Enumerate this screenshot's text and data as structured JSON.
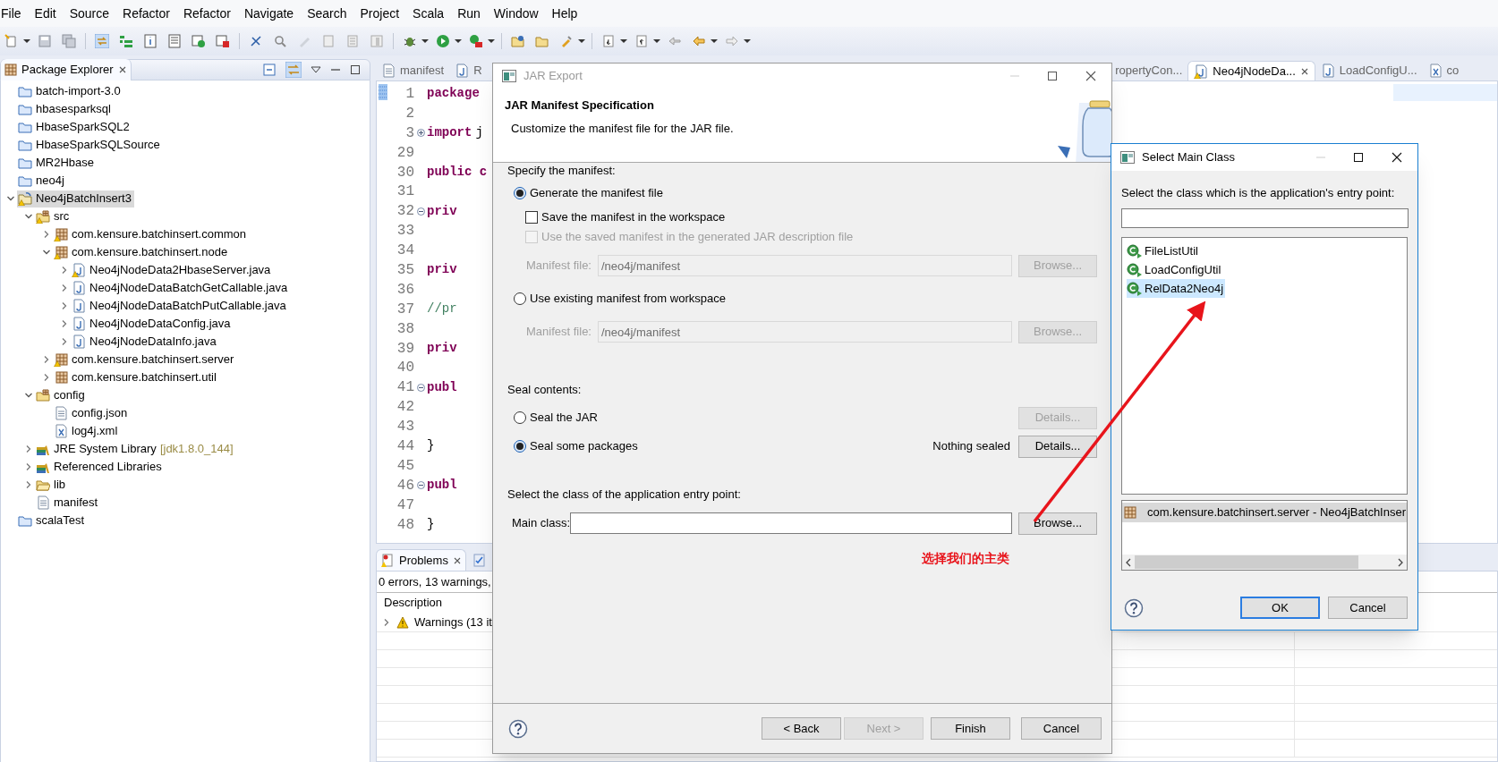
{
  "menu_bar": [
    "File",
    "Edit",
    "Source",
    "Refactor",
    "Refactor",
    "Navigate",
    "Search",
    "Project",
    "Scala",
    "Run",
    "Window",
    "Help"
  ],
  "package_explorer": {
    "title": "Package Explorer",
    "tree": [
      {
        "label": "batch-import-3.0",
        "kind": "project",
        "selected": false,
        "warning": false
      },
      {
        "label": "hbasesparksql",
        "kind": "project",
        "selected": false,
        "warning": false
      },
      {
        "label": "HbaseSparkSQL2",
        "kind": "project",
        "selected": false,
        "warning": false
      },
      {
        "label": "HbaseSparkSQLSource",
        "kind": "project",
        "selected": false,
        "warning": false
      },
      {
        "label": "MR2Hbase",
        "kind": "project",
        "selected": false,
        "warning": false
      },
      {
        "label": "neo4j",
        "kind": "project",
        "selected": false,
        "warning": false
      },
      {
        "label": "Neo4jBatchInsert3",
        "kind": "project_open",
        "selected": true,
        "warning": true,
        "expanded": true,
        "children": [
          {
            "label": "src",
            "kind": "source_folder",
            "selected": false,
            "warning": true,
            "expanded": true,
            "children": [
              {
                "label": "com.kensure.batchinsert.common",
                "kind": "package",
                "selected": false,
                "warning": true,
                "expanded": false
              },
              {
                "label": "com.kensure.batchinsert.node",
                "kind": "package",
                "selected": false,
                "warning": true,
                "expanded": true,
                "children": [
                  {
                    "label": "Neo4jNodeData2HbaseServer.java",
                    "kind": "java",
                    "selected": false,
                    "warning": true,
                    "expanded": false
                  },
                  {
                    "label": "Neo4jNodeDataBatchGetCallable.java",
                    "kind": "java",
                    "selected": false,
                    "warning": false,
                    "expanded": false
                  },
                  {
                    "label": "Neo4jNodeDataBatchPutCallable.java",
                    "kind": "java",
                    "selected": false,
                    "warning": false,
                    "expanded": false
                  },
                  {
                    "label": "Neo4jNodeDataConfig.java",
                    "kind": "java",
                    "selected": false,
                    "warning": false,
                    "expanded": false
                  },
                  {
                    "label": "Neo4jNodeDataInfo.java",
                    "kind": "java",
                    "selected": false,
                    "warning": false,
                    "expanded": false
                  }
                ]
              },
              {
                "label": "com.kensure.batchinsert.server",
                "kind": "package",
                "selected": false,
                "warning": true,
                "expanded": false
              },
              {
                "label": "com.kensure.batchinsert.util",
                "kind": "package",
                "selected": false,
                "warning": false,
                "expanded": false
              }
            ]
          },
          {
            "label": "config",
            "kind": "source_folder",
            "selected": false,
            "warning": false,
            "expanded": true,
            "children": [
              {
                "label": "config.json",
                "kind": "file",
                "selected": false,
                "warning": false
              },
              {
                "label": "log4j.xml",
                "kind": "xml",
                "selected": false,
                "warning": false
              }
            ]
          },
          {
            "label": "JRE System Library",
            "decoration": "[jdk1.8.0_144]",
            "kind": "library",
            "selected": false,
            "warning": false,
            "expanded": false
          },
          {
            "label": "Referenced Libraries",
            "kind": "library",
            "selected": false,
            "warning": false,
            "expanded": false
          },
          {
            "label": "lib",
            "kind": "folder",
            "selected": false,
            "warning": false,
            "expanded": false
          },
          {
            "label": "manifest",
            "kind": "file",
            "selected": false,
            "warning": false
          }
        ]
      },
      {
        "label": "scalaTest",
        "kind": "project",
        "selected": false,
        "warning": false
      }
    ]
  },
  "editor": {
    "tabs": [
      {
        "label": "manifest",
        "kind": "file",
        "selected": false
      },
      {
        "label": "R",
        "kind": "java",
        "selected": false
      },
      {
        "label": "ropertyCon...",
        "selected": false
      },
      {
        "label": "Neo4jNodeDa...",
        "kind": "java_warning",
        "selected": true
      },
      {
        "label": "LoadConfigU...",
        "kind": "java",
        "selected": false
      },
      {
        "label": "co",
        "kind": "xml",
        "selected": false
      }
    ],
    "lines": [
      {
        "number": "1",
        "segments": [
          {
            "text": "package",
            "kind": "keyword"
          }
        ]
      },
      {
        "number": "2"
      },
      {
        "number": "3",
        "folded": true,
        "segments": [
          {
            "text": "import",
            "kind": "keyword"
          },
          {
            "text": "j",
            "kind": "plain"
          }
        ]
      },
      {
        "number": "29"
      },
      {
        "number": "30",
        "segments": [
          {
            "text": "public c",
            "kind": "keyword"
          }
        ]
      },
      {
        "number": "31"
      },
      {
        "number": "32",
        "folded": false,
        "segments": [
          {
            "text": "priv",
            "kind": "keyword"
          }
        ]
      },
      {
        "number": "33"
      },
      {
        "number": "34"
      },
      {
        "number": "35",
        "segments": [
          {
            "text": "priv",
            "kind": "keyword"
          }
        ]
      },
      {
        "number": "36"
      },
      {
        "number": "37",
        "segments": [
          {
            "text": "//pr",
            "kind": "comment"
          }
        ]
      },
      {
        "number": "38"
      },
      {
        "number": "39",
        "segments": [
          {
            "text": "priv",
            "kind": "keyword"
          }
        ]
      },
      {
        "number": "40"
      },
      {
        "number": "41",
        "folded": false,
        "segments": [
          {
            "text": "publ",
            "kind": "keyword"
          }
        ]
      },
      {
        "number": "42"
      },
      {
        "number": "43"
      },
      {
        "number": "44",
        "segments": [
          {
            "text": "}",
            "kind": "plain"
          }
        ]
      },
      {
        "number": "45"
      },
      {
        "number": "46",
        "folded": false,
        "segments": [
          {
            "text": "publ",
            "kind": "keyword"
          }
        ]
      },
      {
        "number": "47"
      },
      {
        "number": "48",
        "segments": [
          {
            "text": "}",
            "kind": "plain"
          }
        ]
      }
    ]
  },
  "problems": {
    "tab": "Problems",
    "summary": "0 errors, 13 warnings,",
    "column": "Description",
    "rows": [
      {
        "label": "Warnings (13 it",
        "expanded": false
      }
    ]
  },
  "jar_export": {
    "title": "JAR Export",
    "heading": "JAR Manifest Specification",
    "description": "Customize the manifest file for the JAR file.",
    "manifest_section": {
      "label": "Specify the manifest:",
      "options": [
        {
          "kind": "radio",
          "label": "Generate the manifest file",
          "selected": true
        },
        {
          "kind": "checkbox",
          "label": "Save the manifest in the workspace",
          "checked": false,
          "disabled": false
        },
        {
          "kind": "checkbox",
          "label": "Use the saved manifest in the generated JAR description file",
          "checked": false,
          "disabled": true
        },
        {
          "kind": "field",
          "label": "Manifest file:",
          "value": "/neo4j/manifest",
          "button": "Browse...",
          "disabled": true
        },
        {
          "kind": "radio",
          "label": "Use existing manifest from workspace",
          "selected": false
        },
        {
          "kind": "field",
          "label": "Manifest file:",
          "value": "/neo4j/manifest",
          "button": "Browse...",
          "disabled": true
        }
      ]
    },
    "seal_section": {
      "label": "Seal contents:",
      "options": [
        {
          "label": "Seal the JAR",
          "selected": false,
          "button": "Details...",
          "button_disabled": true
        },
        {
          "label": "Seal some packages",
          "selected": true,
          "note": "Nothing sealed",
          "button": "Details...",
          "button_disabled": false
        }
      ]
    },
    "main_class": {
      "label": "Select the class of the application entry point:",
      "field_label": "Main class:",
      "button": "Browse..."
    },
    "buttons": [
      {
        "label": "< Back",
        "disabled": false
      },
      {
        "label": "Next >",
        "disabled": true
      },
      {
        "label": "Finish",
        "disabled": false
      },
      {
        "label": "Cancel",
        "disabled": false
      }
    ]
  },
  "select_main_class": {
    "title": "Select Main Class",
    "prompt": "Select the class which is the application's entry point:",
    "classes": [
      {
        "label": "FileListUtil",
        "selected": false
      },
      {
        "label": "LoadConfigUtil",
        "selected": false
      },
      {
        "label": "RelData2Neo4j",
        "selected": true
      }
    ],
    "packages": [
      {
        "label": "com.kensure.batchinsert.server - Neo4jBatchInser",
        "selected": true
      }
    ],
    "buttons": [
      {
        "label": "OK",
        "default": true
      },
      {
        "label": "Cancel",
        "default": false
      }
    ]
  },
  "annotation": {
    "text": "选择我们的主类"
  }
}
